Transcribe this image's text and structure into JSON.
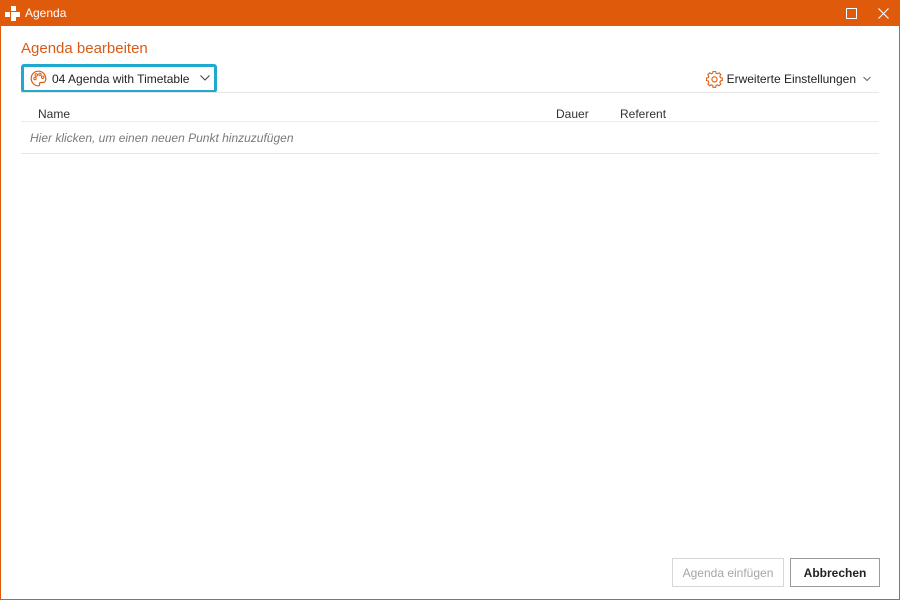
{
  "window": {
    "title": "Agenda",
    "accent_color": "#e05a0c",
    "controls": [
      "maximize-icon",
      "close-icon"
    ]
  },
  "dialog": {
    "heading": "Agenda bearbeiten",
    "heading_color": "#d95b17",
    "layout_select": {
      "value": "04 Agenda with Timetable",
      "icon": "palette-icon",
      "focus_color": "#1fa9cf"
    },
    "advanced_settings": {
      "label": "Erweiterte Einstellungen",
      "icon": "gear-icon"
    }
  },
  "table": {
    "columns": [
      "Name",
      "Dauer",
      "Referent"
    ],
    "add_placeholder": "Hier klicken, um einen neuen Punkt hinzuzufügen",
    "rows": []
  },
  "footer": {
    "insert_label": "Agenda einfügen",
    "insert_enabled": false,
    "cancel_label": "Abbrechen"
  }
}
